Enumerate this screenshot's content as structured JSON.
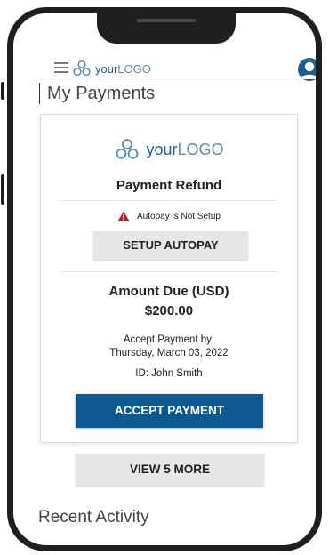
{
  "header": {
    "logo": {
      "prefix": "your",
      "suffix": "LOGO"
    }
  },
  "page": {
    "title": "My Payments"
  },
  "card": {
    "logo": {
      "prefix": "your",
      "suffix": "LOGO"
    },
    "heading": "Payment Refund",
    "warning": "Autopay is Not Setup",
    "setup_button": "SETUP AUTOPAY",
    "amount_label": "Amount Due (USD)",
    "amount_value": "$200.00",
    "accept_by_line1": "Accept Payment by:",
    "accept_by_line2": "Thursday, March 03, 2022",
    "id_line": "ID: John Smith",
    "accept_button": "ACCEPT PAYMENT"
  },
  "view_more_button": "VIEW 5 MORE",
  "recent_activity": "Recent Activity",
  "icons": {
    "menu": "hamburger-icon",
    "logo": "logo-icon",
    "avatar": "user-avatar-icon",
    "warning": "warning-icon"
  },
  "colors": {
    "brand_blue": "#0d5a93",
    "logo_blue": "#1c5f92",
    "warning_red": "#d0191f",
    "button_grey": "#e6e6e6"
  }
}
